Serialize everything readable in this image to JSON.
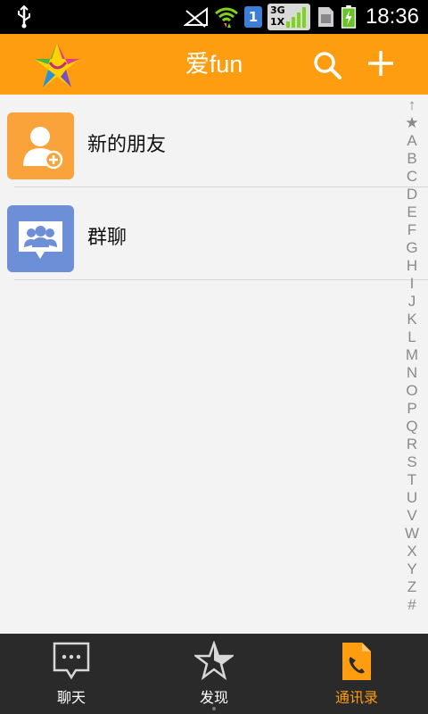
{
  "status_bar": {
    "time": "18:36",
    "sim_slot": "1",
    "network_type_top": "3G",
    "network_type_bottom": "1X",
    "icons": [
      "usb-icon",
      "no-signal-icon",
      "wifi-icon",
      "sim-badge",
      "network-badge",
      "sim-card-icon",
      "battery-charging-icon"
    ]
  },
  "header": {
    "title": "爱fun",
    "icons": [
      "app-logo",
      "search-icon",
      "add-icon"
    ],
    "color": "#ff9d11"
  },
  "contacts_menu": [
    {
      "label": "新的朋友",
      "icon": "new-friend-icon",
      "color": "#fba33b"
    },
    {
      "label": "群聊",
      "icon": "group-chat-icon",
      "color": "#6d8fd8"
    }
  ],
  "alphabet_index": [
    "↑",
    "★",
    "A",
    "B",
    "C",
    "D",
    "E",
    "F",
    "G",
    "H",
    "I",
    "J",
    "K",
    "L",
    "M",
    "N",
    "O",
    "P",
    "Q",
    "R",
    "S",
    "T",
    "U",
    "V",
    "W",
    "X",
    "Y",
    "Z",
    "#"
  ],
  "bottom_nav": {
    "tabs": [
      {
        "label": "聊天",
        "icon": "chat-bubble-icon",
        "active": false
      },
      {
        "label": "发现",
        "icon": "star-icon",
        "active": false
      },
      {
        "label": "通讯录",
        "icon": "contacts-book-icon",
        "active": true
      }
    ],
    "active_color": "#ff9d11"
  }
}
